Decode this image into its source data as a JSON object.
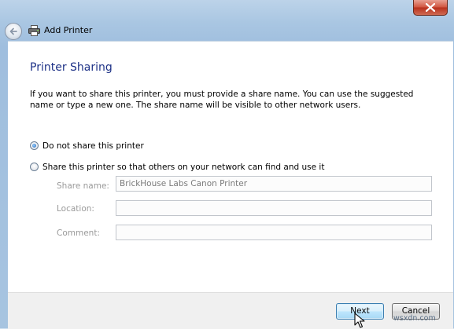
{
  "window": {
    "title": "Add Printer"
  },
  "page": {
    "heading": "Printer Sharing",
    "description": "If you want to share this printer, you must provide a share name. You can use the suggested name or type a new one. The share name will be visible to other network users."
  },
  "sharing_options": [
    {
      "label": "Do not share this printer",
      "selected": true
    },
    {
      "label": "Share this printer so that others on your network can find and use it",
      "selected": false
    }
  ],
  "fields": {
    "share_name": {
      "label": "Share name:",
      "value": "BrickHouse Labs Canon Printer"
    },
    "location": {
      "label": "Location:",
      "value": ""
    },
    "comment": {
      "label": "Comment:",
      "value": ""
    }
  },
  "buttons": {
    "next": "Next",
    "cancel": "Cancel"
  },
  "watermark": "wsxdn.com",
  "colors": {
    "heading": "#1e3287",
    "close_button": "#c9452f",
    "primary_button_border": "#3c7fb1"
  },
  "icons": [
    "close-icon",
    "back-arrow-icon",
    "printer-icon",
    "mouse-cursor-icon"
  ]
}
